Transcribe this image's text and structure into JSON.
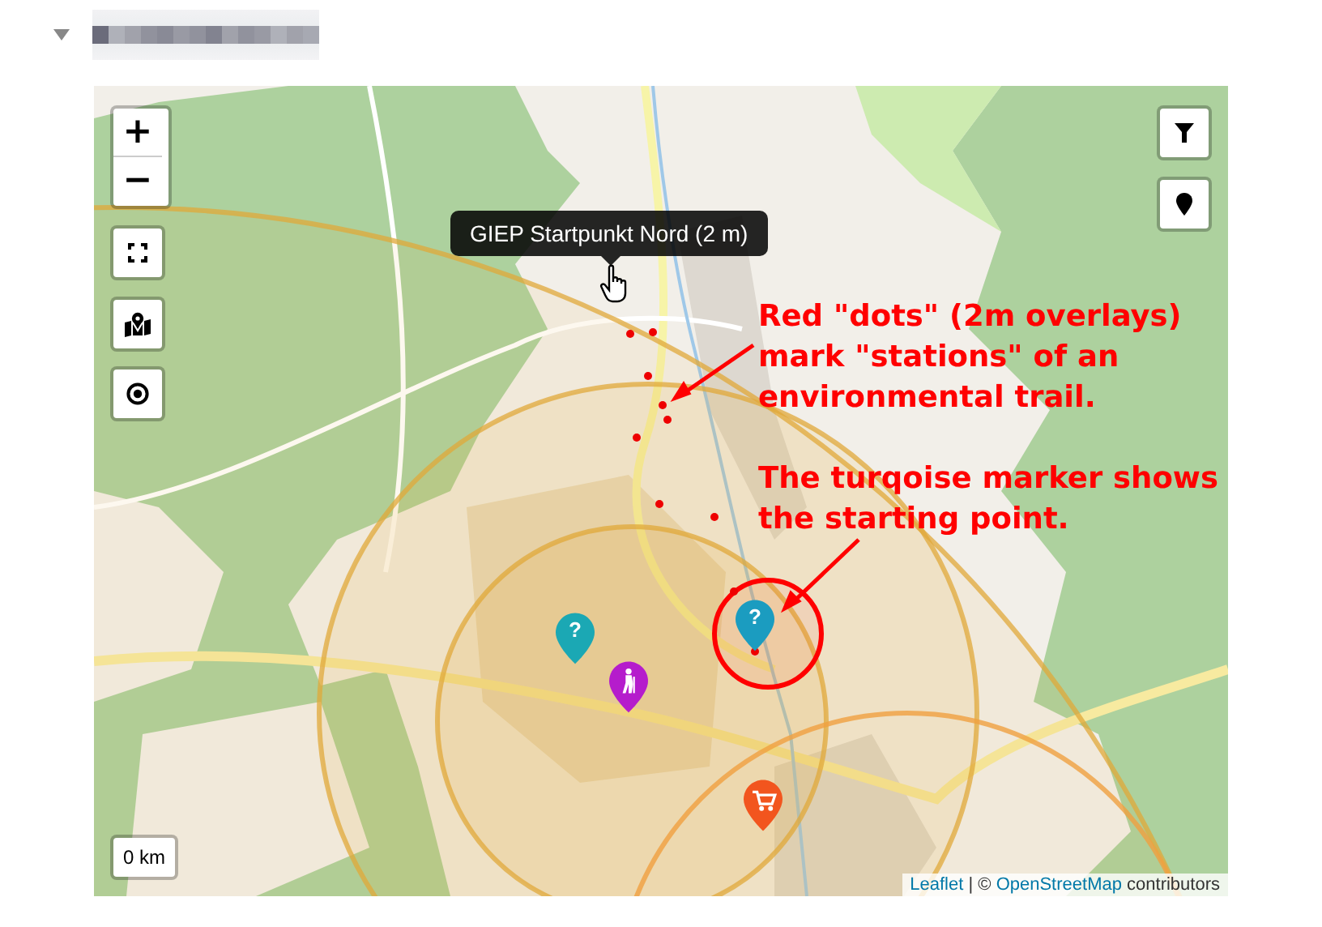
{
  "section": {
    "expanded": true
  },
  "map": {
    "zoom_controls": [
      "+",
      "−"
    ],
    "tooltip": "GIEP Startpunkt Nord (2 m)",
    "annotations": [
      {
        "lines": [
          "Red \"dots\" (2m overlays)",
          "mark \"stations\" of an",
          "environmental trail."
        ]
      },
      {
        "lines": [
          "The turqoise marker shows",
          "the starting point."
        ]
      }
    ],
    "markers": [
      {
        "kind": "question",
        "symbol": "?",
        "color": "#1b9cc0"
      },
      {
        "kind": "question",
        "symbol": "?",
        "color": "#1ba8b4"
      },
      {
        "kind": "hiker",
        "color": "#b51ccc"
      },
      {
        "kind": "cart",
        "color": "#f2551e"
      }
    ],
    "scale": "0 km",
    "attribution": [
      {
        "kind": "link",
        "text": "Leaflet"
      },
      {
        "kind": "text",
        "text": " | © "
      },
      {
        "kind": "link",
        "text": "OpenStreetMap"
      },
      {
        "kind": "text",
        "text": " contributors"
      }
    ]
  }
}
